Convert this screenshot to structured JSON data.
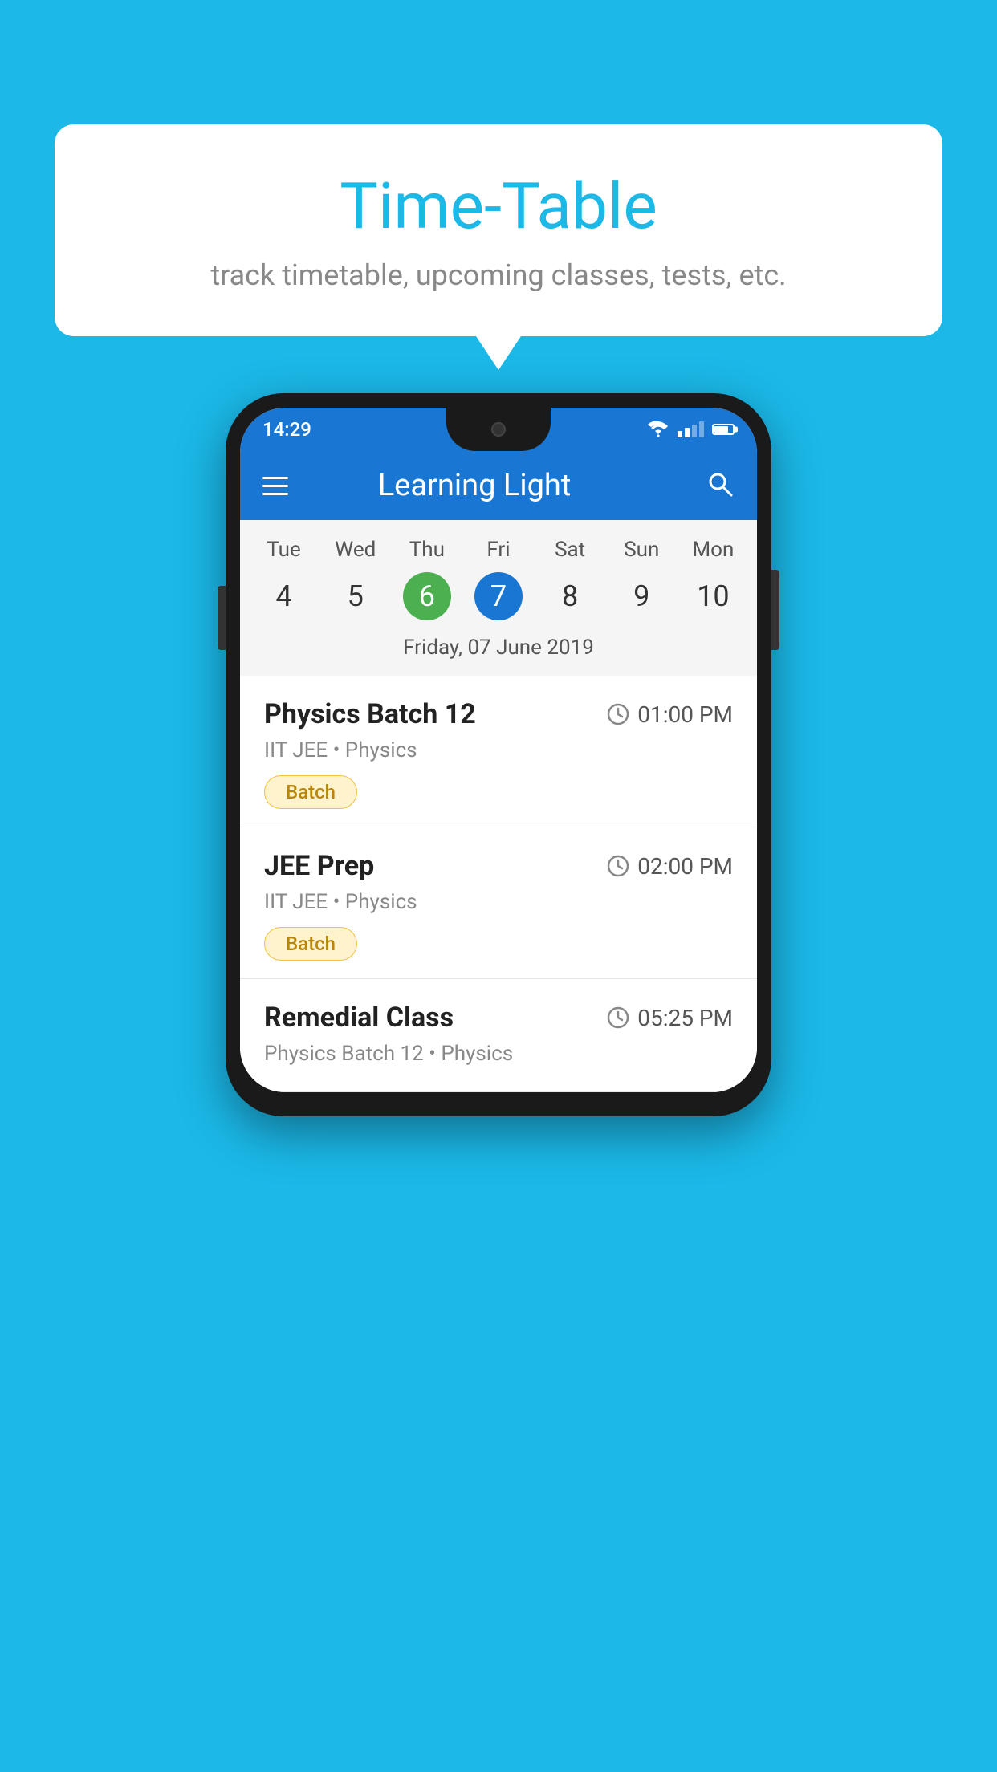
{
  "background_color": "#1BB8E8",
  "speech_bubble": {
    "title": "Time-Table",
    "subtitle": "track timetable, upcoming classes, tests, etc."
  },
  "phone": {
    "status_bar": {
      "time": "14:29"
    },
    "app_bar": {
      "title": "Learning Light"
    },
    "calendar": {
      "days": [
        {
          "short": "Tue",
          "num": "4"
        },
        {
          "short": "Wed",
          "num": "5"
        },
        {
          "short": "Thu",
          "num": "6",
          "state": "today"
        },
        {
          "short": "Fri",
          "num": "7",
          "state": "selected"
        },
        {
          "short": "Sat",
          "num": "8"
        },
        {
          "short": "Sun",
          "num": "9"
        },
        {
          "short": "Mon",
          "num": "10"
        }
      ],
      "selected_date_label": "Friday, 07 June 2019"
    },
    "schedule": [
      {
        "title": "Physics Batch 12",
        "time": "01:00 PM",
        "subtitle": "IIT JEE • Physics",
        "badge": "Batch"
      },
      {
        "title": "JEE Prep",
        "time": "02:00 PM",
        "subtitle": "IIT JEE • Physics",
        "badge": "Batch"
      },
      {
        "title": "Remedial Class",
        "time": "05:25 PM",
        "subtitle": "Physics Batch 12 • Physics",
        "badge": null
      }
    ]
  }
}
